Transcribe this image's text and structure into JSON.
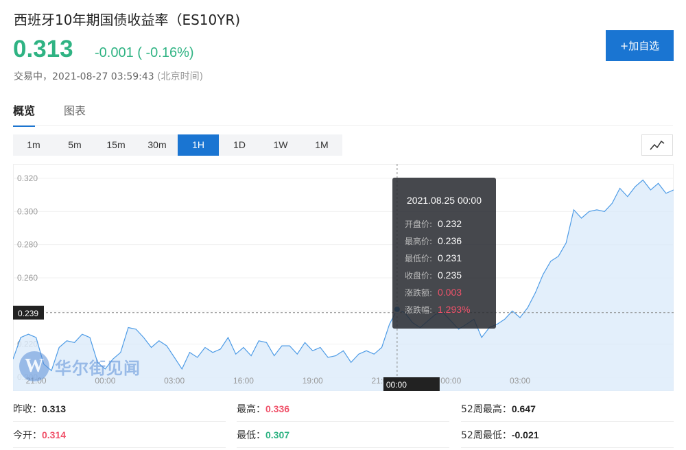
{
  "header": {
    "title": "西班牙10年期国债收益率（ES10YR)",
    "price": "0.313",
    "change": "-0.001 ( -0.16%)",
    "status": "交易中，",
    "datetime": "2021-08-27 03:59:43",
    "timezone": "(北京时间)",
    "add_button": "+加自选",
    "accent_color": "#1a75d2",
    "down_color": "#2fb383",
    "up_color": "#f0526a"
  },
  "tabs": [
    {
      "label": "概览",
      "active": true
    },
    {
      "label": "图表",
      "active": false
    }
  ],
  "intervals": [
    {
      "label": "1m",
      "active": false
    },
    {
      "label": "5m",
      "active": false
    },
    {
      "label": "15m",
      "active": false
    },
    {
      "label": "30m",
      "active": false
    },
    {
      "label": "1H",
      "active": true
    },
    {
      "label": "1D",
      "active": false
    },
    {
      "label": "1W",
      "active": false
    },
    {
      "label": "1M",
      "active": false
    }
  ],
  "chart_toggle_icon": "line-chart-icon",
  "tooltip": {
    "date": "2021.08.25 00:00",
    "rows": [
      {
        "label": "开盘价:",
        "value": "0.232",
        "color": "white"
      },
      {
        "label": "最高价:",
        "value": "0.236",
        "color": "white"
      },
      {
        "label": "最低价:",
        "value": "0.231",
        "color": "white"
      },
      {
        "label": "收盘价:",
        "value": "0.235",
        "color": "white"
      },
      {
        "label": "涨跌额:",
        "value": "0.003",
        "color": "red"
      },
      {
        "label": "涨跌幅:",
        "value": "1.293%",
        "color": "red"
      }
    ]
  },
  "crosshair": {
    "y_label": "0.239",
    "x_label": "00:00"
  },
  "watermark": {
    "logo_letter": "W",
    "text": "华尔街见闻"
  },
  "chart_data": {
    "type": "area",
    "ylim": [
      0.2,
      0.33
    ],
    "y_ticks": [
      "0.320",
      "0.300",
      "0.280",
      "0.260",
      "0.240",
      "0.220",
      "0.200"
    ],
    "y_tick_values": [
      0.32,
      0.3,
      0.28,
      0.26,
      0.24,
      0.22,
      0.2
    ],
    "x_tick_labels": [
      "21:00",
      "00:00",
      "03:00",
      "16:00",
      "19:00",
      "21:00",
      "00:00",
      "03:00"
    ],
    "x_tick_positions": [
      3,
      12,
      21,
      30,
      39,
      48,
      57,
      66
    ],
    "crosshair_index": 50,
    "grid": true,
    "line_color": "#4d9be6",
    "fill_color": "#dcebfa",
    "series": [
      {
        "values": [
          0.211,
          0.224,
          0.226,
          0.224,
          0.208,
          0.204,
          0.218,
          0.222,
          0.221,
          0.226,
          0.224,
          0.209,
          0.205,
          0.211,
          0.215,
          0.23,
          0.229,
          0.224,
          0.218,
          0.222,
          0.219,
          0.212,
          0.205,
          0.215,
          0.212,
          0.218,
          0.215,
          0.217,
          0.224,
          0.214,
          0.218,
          0.213,
          0.222,
          0.221,
          0.213,
          0.219,
          0.219,
          0.214,
          0.221,
          0.216,
          0.218,
          0.212,
          0.213,
          0.216,
          0.209,
          0.214,
          0.216,
          0.214,
          0.218,
          0.232,
          0.241,
          0.239,
          0.233,
          0.23,
          0.234,
          0.238,
          0.239,
          0.234,
          0.229,
          0.232,
          0.235,
          0.224,
          0.23,
          0.232,
          0.235,
          0.24,
          0.236,
          0.242,
          0.251,
          0.262,
          0.27,
          0.273,
          0.281,
          0.301,
          0.296,
          0.3,
          0.301,
          0.3,
          0.305,
          0.314,
          0.309,
          0.315,
          0.319,
          0.313,
          0.317,
          0.311,
          0.313
        ]
      }
    ]
  },
  "stats": [
    {
      "label": "昨收：",
      "value": "0.313",
      "tone": "dark"
    },
    {
      "label": "最高：",
      "value": "0.336",
      "tone": "red"
    },
    {
      "label": "52周最高：",
      "value": "0.647",
      "tone": "dark"
    },
    {
      "label": "今开：",
      "value": "0.314",
      "tone": "red"
    },
    {
      "label": "最低：",
      "value": "0.307",
      "tone": "green"
    },
    {
      "label": "52周最低：",
      "value": "-0.021",
      "tone": "dark"
    }
  ]
}
